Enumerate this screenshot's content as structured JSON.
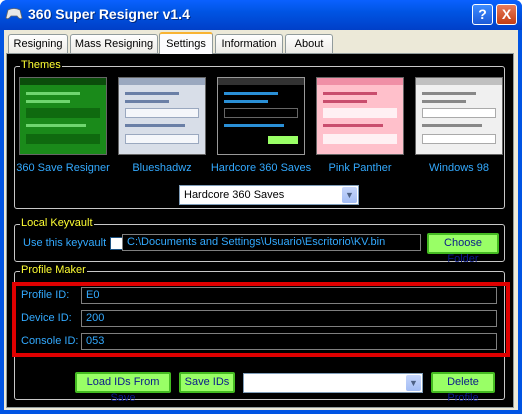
{
  "window": {
    "title": "360 Super Resigner v1.4",
    "help": "?",
    "close": "X"
  },
  "tabs": [
    {
      "label": "Resigning"
    },
    {
      "label": "Mass Resigning"
    },
    {
      "label": "Settings"
    },
    {
      "label": "Information"
    },
    {
      "label": "About"
    }
  ],
  "themes": {
    "group_label": "Themes",
    "items": [
      {
        "label": "360 Save Resigner"
      },
      {
        "label": "Blueshadwz"
      },
      {
        "label": "Hardcore 360 Saves"
      },
      {
        "label": "Pink Panther"
      },
      {
        "label": "Windows 98"
      }
    ],
    "selected": "Hardcore 360 Saves"
  },
  "keyvault": {
    "group_label": "Local Keyvault",
    "use_label": "Use this keyvault",
    "path": "C:\\Documents and Settings\\Usuario\\Escritorio\\KV.bin",
    "choose_button": "Choose Folder"
  },
  "profile": {
    "group_label": "Profile Maker",
    "profile_id_label": "Profile ID:",
    "profile_id_value": "E0",
    "device_id_label": "Device ID:",
    "device_id_value": "200",
    "console_id_label": "Console ID:",
    "console_id_value": "053",
    "load_button": "Load IDs From Save",
    "save_button": "Save IDs",
    "profile_select": "",
    "delete_button": "Delete Profile"
  }
}
